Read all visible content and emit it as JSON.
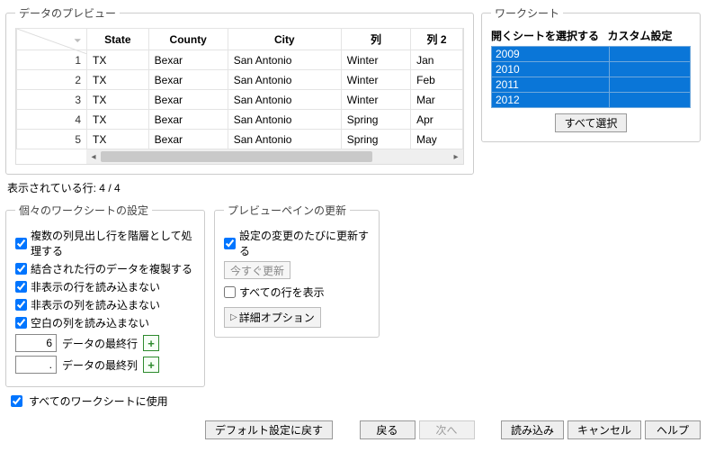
{
  "preview": {
    "legend": "データのプレビュー",
    "columns": [
      "State",
      "County",
      "City",
      "列",
      "列 2"
    ],
    "rows": [
      {
        "n": "1",
        "cells": [
          "TX",
          "Bexar",
          "San Antonio",
          "Winter",
          "Jan"
        ]
      },
      {
        "n": "2",
        "cells": [
          "TX",
          "Bexar",
          "San Antonio",
          "Winter",
          "Feb"
        ]
      },
      {
        "n": "3",
        "cells": [
          "TX",
          "Bexar",
          "San Antonio",
          "Winter",
          "Mar"
        ]
      },
      {
        "n": "4",
        "cells": [
          "TX",
          "Bexar",
          "San Antonio",
          "Spring",
          "Apr"
        ]
      },
      {
        "n": "5",
        "cells": [
          "TX",
          "Bexar",
          "San Antonio",
          "Spring",
          "May"
        ]
      }
    ]
  },
  "rows_status": "表示されている行: 4 / 4",
  "worksheets": {
    "legend": "ワークシート",
    "h1": "開くシートを選択する",
    "h2": "カスタム設定",
    "items": [
      "2009",
      "2010",
      "2011",
      "2012"
    ],
    "select_all": "すべて選択"
  },
  "indiv": {
    "legend": "個々のワークシートの設定",
    "c1": "複数の列見出し行を階層として処理する",
    "c2": "結合された行のデータを複製する",
    "c3": "非表示の行を読み込まない",
    "c4": "非表示の列を読み込まない",
    "c5": "空白の列を読み込まない",
    "last_row_val": "6",
    "last_row_lbl": "データの最終行",
    "last_col_val": ".",
    "last_col_lbl": "データの最終列"
  },
  "refresh": {
    "legend": "プレビューペインの更新",
    "auto": "設定の変更のたびに更新する",
    "now": "今すぐ更新",
    "all_rows": "すべての行を表示",
    "advanced": "詳細オプション"
  },
  "apply_all": "すべてのワークシートに使用",
  "buttons": {
    "defaults": "デフォルト設定に戻す",
    "back": "戻る",
    "next": "次へ",
    "load": "読み込み",
    "cancel": "キャンセル",
    "help": "ヘルプ"
  }
}
